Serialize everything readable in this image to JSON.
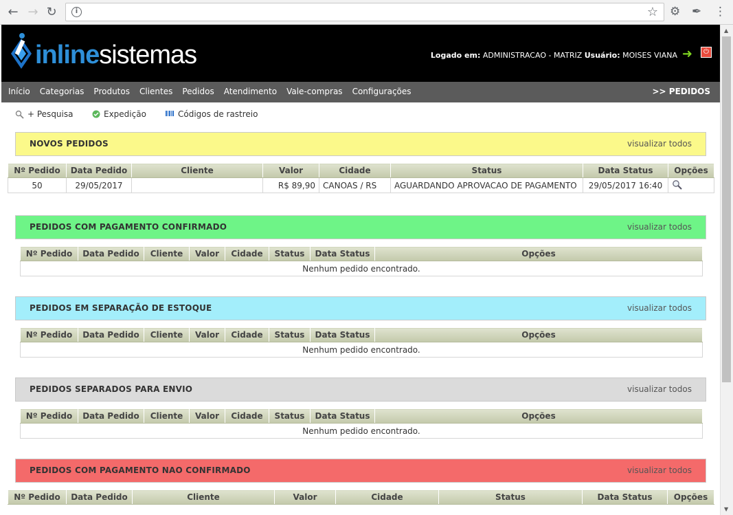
{
  "browser": {
    "back_icon": "back-arrow-icon",
    "forward_icon": "forward-arrow-icon",
    "reload_icon": "reload-icon",
    "address_value": ""
  },
  "header": {
    "logo_part1": "inline",
    "logo_part2": "sistemas",
    "logged_label": "Logado em:",
    "logged_value": "ADMINISTRACAO - MATRIZ",
    "user_label": "Usuário:",
    "user_value": "MOISES VIANA"
  },
  "menu": {
    "items": [
      "Início",
      "Categorias",
      "Produtos",
      "Clientes",
      "Pedidos",
      "Atendimento",
      "Vale-compras",
      "Configurações"
    ],
    "breadcrumb": ">> PEDIDOS"
  },
  "toolbar": {
    "search": "+ Pesquisa",
    "expedicao": "Expedição",
    "rastreio": "Códigos de rastreio"
  },
  "sections": [
    {
      "title": "NOVOS PEDIDOS",
      "link": "visualizar todos",
      "color": "#fbf98a",
      "columns": [
        "Nº Pedido",
        "Data Pedido",
        "Cliente",
        "Valor",
        "Cidade",
        "Status",
        "Data Status",
        "Opções"
      ],
      "rows": [
        {
          "pedido": "50",
          "data": "29/05/2017",
          "cliente": "",
          "valor": "R$ 89,90",
          "cidade": "CANOAS / RS",
          "status": "AGUARDANDO APROVACAO DE PAGAMENTO",
          "data_status": "29/05/2017 16:40"
        }
      ]
    },
    {
      "title": "PEDIDOS COM PAGAMENTO CONFIRMADO",
      "link": "visualizar todos",
      "color": "#6ef487",
      "columns": [
        "Nº Pedido",
        "Data Pedido",
        "Cliente",
        "Valor",
        "Cidade",
        "Status",
        "Data Status",
        "Opções"
      ],
      "empty": "Nenhum pedido encontrado."
    },
    {
      "title": "PEDIDOS EM SEPARAÇÃO DE ESTOQUE",
      "link": "visualizar todos",
      "color": "#a3eefb",
      "columns": [
        "Nº Pedido",
        "Data Pedido",
        "Cliente",
        "Valor",
        "Cidade",
        "Status",
        "Data Status",
        "Opções"
      ],
      "empty": "Nenhum pedido encontrado."
    },
    {
      "title": "PEDIDOS SEPARADOS PARA ENVIO",
      "link": "visualizar todos",
      "color": "#dbdbdb",
      "columns": [
        "Nº Pedido",
        "Data Pedido",
        "Cliente",
        "Valor",
        "Cidade",
        "Status",
        "Data Status",
        "Opções"
      ],
      "empty": "Nenhum pedido encontrado."
    },
    {
      "title": "PEDIDOS COM PAGAMENTO NAO CONFIRMADO",
      "link": "visualizar todos",
      "color": "#f46a6a",
      "columns": [
        "Nº Pedido",
        "Data Pedido",
        "Cliente",
        "Valor",
        "Cidade",
        "Status",
        "Data Status",
        "Opções"
      ]
    }
  ]
}
